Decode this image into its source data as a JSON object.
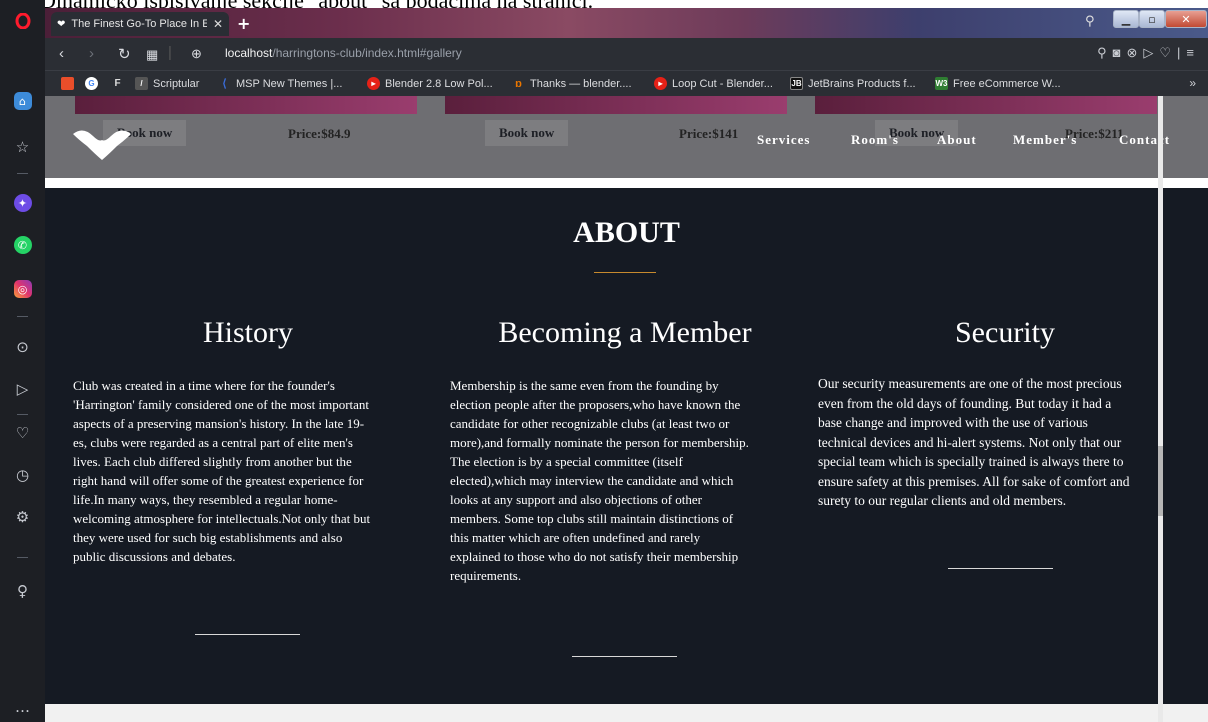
{
  "caption": "Dinamičko ispisivanje sekcije \"about\" sa podacima na stranici.",
  "browser": {
    "tab_title": "The Finest Go-To Place In E",
    "url_host": "localhost",
    "url_path": "/harringtons-club/index.html#gallery",
    "bookmarks": [
      {
        "label": "",
        "icon": "apps-grid-icon",
        "color": "#e94e2a"
      },
      {
        "label": "",
        "icon": "google-icon",
        "color": "#4285f4"
      },
      {
        "label": "",
        "icon": "f-icon",
        "color": "#2b2e34"
      },
      {
        "label": "Scriptular",
        "icon": "scriptular-icon",
        "color": "#555"
      },
      {
        "label": "MSP New Themes |...",
        "icon": "msp-icon",
        "color": "#3a6cd9"
      },
      {
        "label": "Blender 2.8 Low Pol...",
        "icon": "youtube-icon",
        "color": "#e62117"
      },
      {
        "label": "Thanks — blender....",
        "icon": "blender-icon",
        "color": "#ea7600"
      },
      {
        "label": "Loop Cut - Blender...",
        "icon": "youtube-icon",
        "color": "#e62117"
      },
      {
        "label": "JetBrains Products f...",
        "icon": "jetbrains-icon",
        "color": "#111"
      },
      {
        "label": "Free eCommerce W...",
        "icon": "w3-icon",
        "color": "#2f7d32"
      }
    ],
    "more": "»"
  },
  "gallery": {
    "items": [
      {
        "button": "Book now",
        "price": "Price:$84.9"
      },
      {
        "button": "Book now",
        "price": "Price:$141"
      },
      {
        "button": "Book now",
        "price": "Price:$211"
      }
    ]
  },
  "nav": {
    "links": [
      "Services",
      "Room's",
      "About",
      "Member's",
      "Contact"
    ]
  },
  "about": {
    "title": "ABOUT",
    "columns": [
      {
        "title": "History",
        "lines": [
          "Club was created in a time where for the founder's",
          "'Harrington' family considered one of the most important",
          "aspects of a preserving mansion's history. In the late 19-",
          "es, clubs were regarded as a central part of elite men's",
          "lives. Each club differed slightly from another but the",
          "right hand will offer some of the greatest experience for",
          "life.In many ways, they resembled a regular home-",
          "welcoming atmosphere for intellectuals.Not only that but",
          "they were used for such big establishments and also",
          "public discussions and debates."
        ]
      },
      {
        "title": "Becoming a Member",
        "lines": [
          "Membership is the same even from the founding by",
          "election people after the proposers,who have known the",
          "candidate for other recognizable clubs (at least two or",
          "more),and formally nominate the person for membership.",
          "The election is by a special committee (itself",
          "elected),which may interview the candidate and which",
          "looks at any support and also objections of other",
          "members. Some top clubs still maintain distinctions of",
          "this matter which are often undefined and rarely",
          "explained to those who do not satisfy their membership",
          "requirements."
        ]
      },
      {
        "title": "Security",
        "lines": [
          "Our security measurements are one of the most precious",
          "even from the old days of founding. But today it had a",
          "base change and improved with the use of various",
          "technical devices and hi-alert systems. Not only that our",
          "special team which is specially trained is always there to",
          "ensure safety at this premises. All for sake of comfort and",
          "surety to our regular clients and old members."
        ]
      }
    ]
  }
}
